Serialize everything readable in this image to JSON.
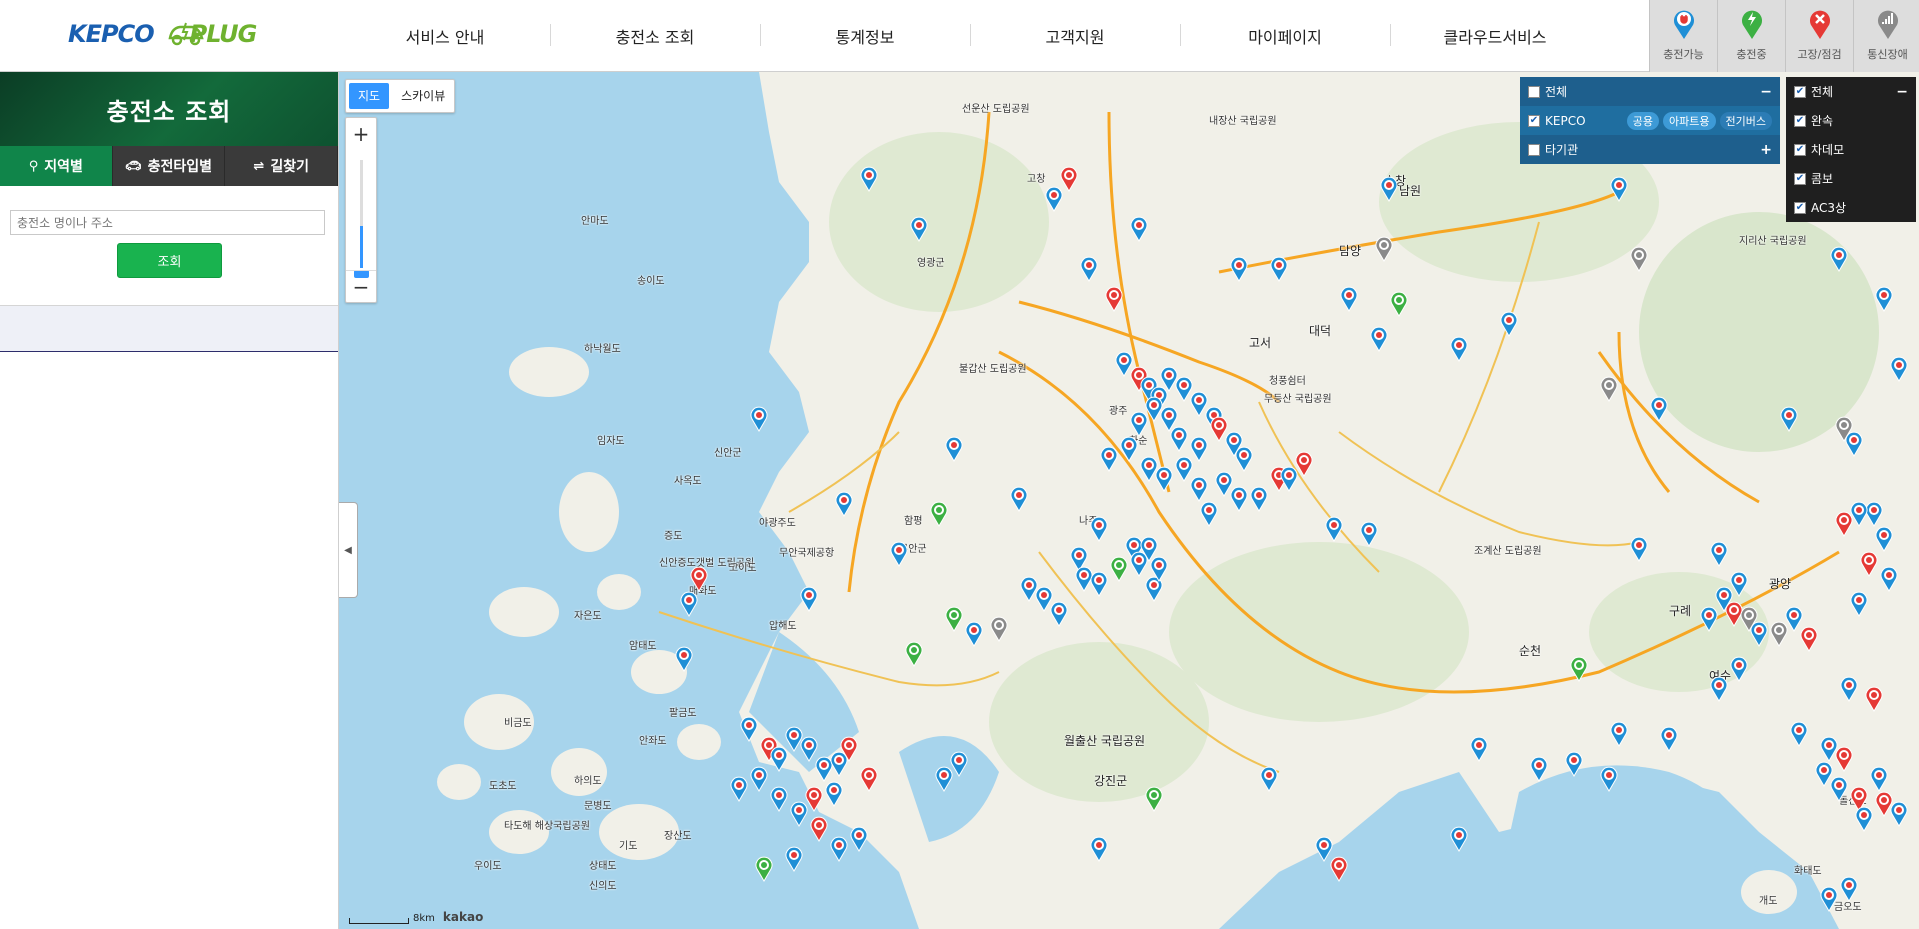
{
  "header": {
    "logo_left": "KEPCO",
    "logo_right": "PLUG",
    "nav": [
      "서비스 안내",
      "충전소 조회",
      "통계정보",
      "고객지원",
      "마이페이지",
      "클라우드서비스"
    ],
    "legend": [
      {
        "label": "충전가능",
        "color": "#1f8fd6",
        "icon": "plug-icon"
      },
      {
        "label": "충전중",
        "color": "#3cb043",
        "icon": "bolt-icon"
      },
      {
        "label": "고장/점검",
        "color": "#e53935",
        "icon": "wrench-icon"
      },
      {
        "label": "통신장애",
        "color": "#8a8a8a",
        "icon": "signal-icon"
      }
    ]
  },
  "sidebar": {
    "title": "충전소 조회",
    "tabs": [
      {
        "label": "지역별",
        "icon": "pin-icon"
      },
      {
        "label": "충전타입별",
        "icon": "car-icon"
      },
      {
        "label": "길찾기",
        "icon": "route-icon"
      }
    ],
    "search_placeholder": "충전소 명이나 주소",
    "search_button": "조회"
  },
  "map": {
    "type_buttons": [
      "지도",
      "스카이뷰"
    ],
    "zoom_in": "+",
    "zoom_out": "−",
    "filter_operator": {
      "all_label": "전체",
      "kepco_label": "KEPCO",
      "kepco_tags": [
        "공용",
        "아파트용",
        "전기버스"
      ],
      "other_label": "타기관"
    },
    "filter_type": {
      "all_label": "전체",
      "items": [
        "완속",
        "차데모",
        "콤보",
        "AC3상"
      ]
    },
    "scale_label": "8km",
    "provider": "kakao",
    "place_labels": [
      "선운산 도립공원",
      "내장산 국립공원",
      "고창",
      "안마도",
      "송이도",
      "영광군",
      "하낙월도",
      "불갑산 도립공원",
      "임자도",
      "신안군",
      "사옥도",
      "증도",
      "신안증도갯벌 도립공원",
      "매화도",
      "자은도",
      "암태도",
      "팔금도",
      "비금도",
      "안좌도",
      "도초도",
      "문병도",
      "장산도",
      "하의도",
      "기도",
      "상태도",
      "신의도",
      "우이도",
      "타도해 해상국립공원",
      "함평",
      "무안군",
      "야광주도",
      "무안국제공항",
      "고이도",
      "압해도",
      "나주",
      "광주",
      "순창",
      "담양",
      "대덕",
      "고서",
      "청풍쉼터",
      "무등산 국립공원",
      "화순",
      "조계산 도립공원",
      "월출산 국립공원",
      "강진군",
      "순천",
      "광양",
      "여수",
      "남원",
      "구례",
      "지리산 국립공원",
      "돌산도",
      "화태도",
      "개도",
      "금오도"
    ]
  }
}
